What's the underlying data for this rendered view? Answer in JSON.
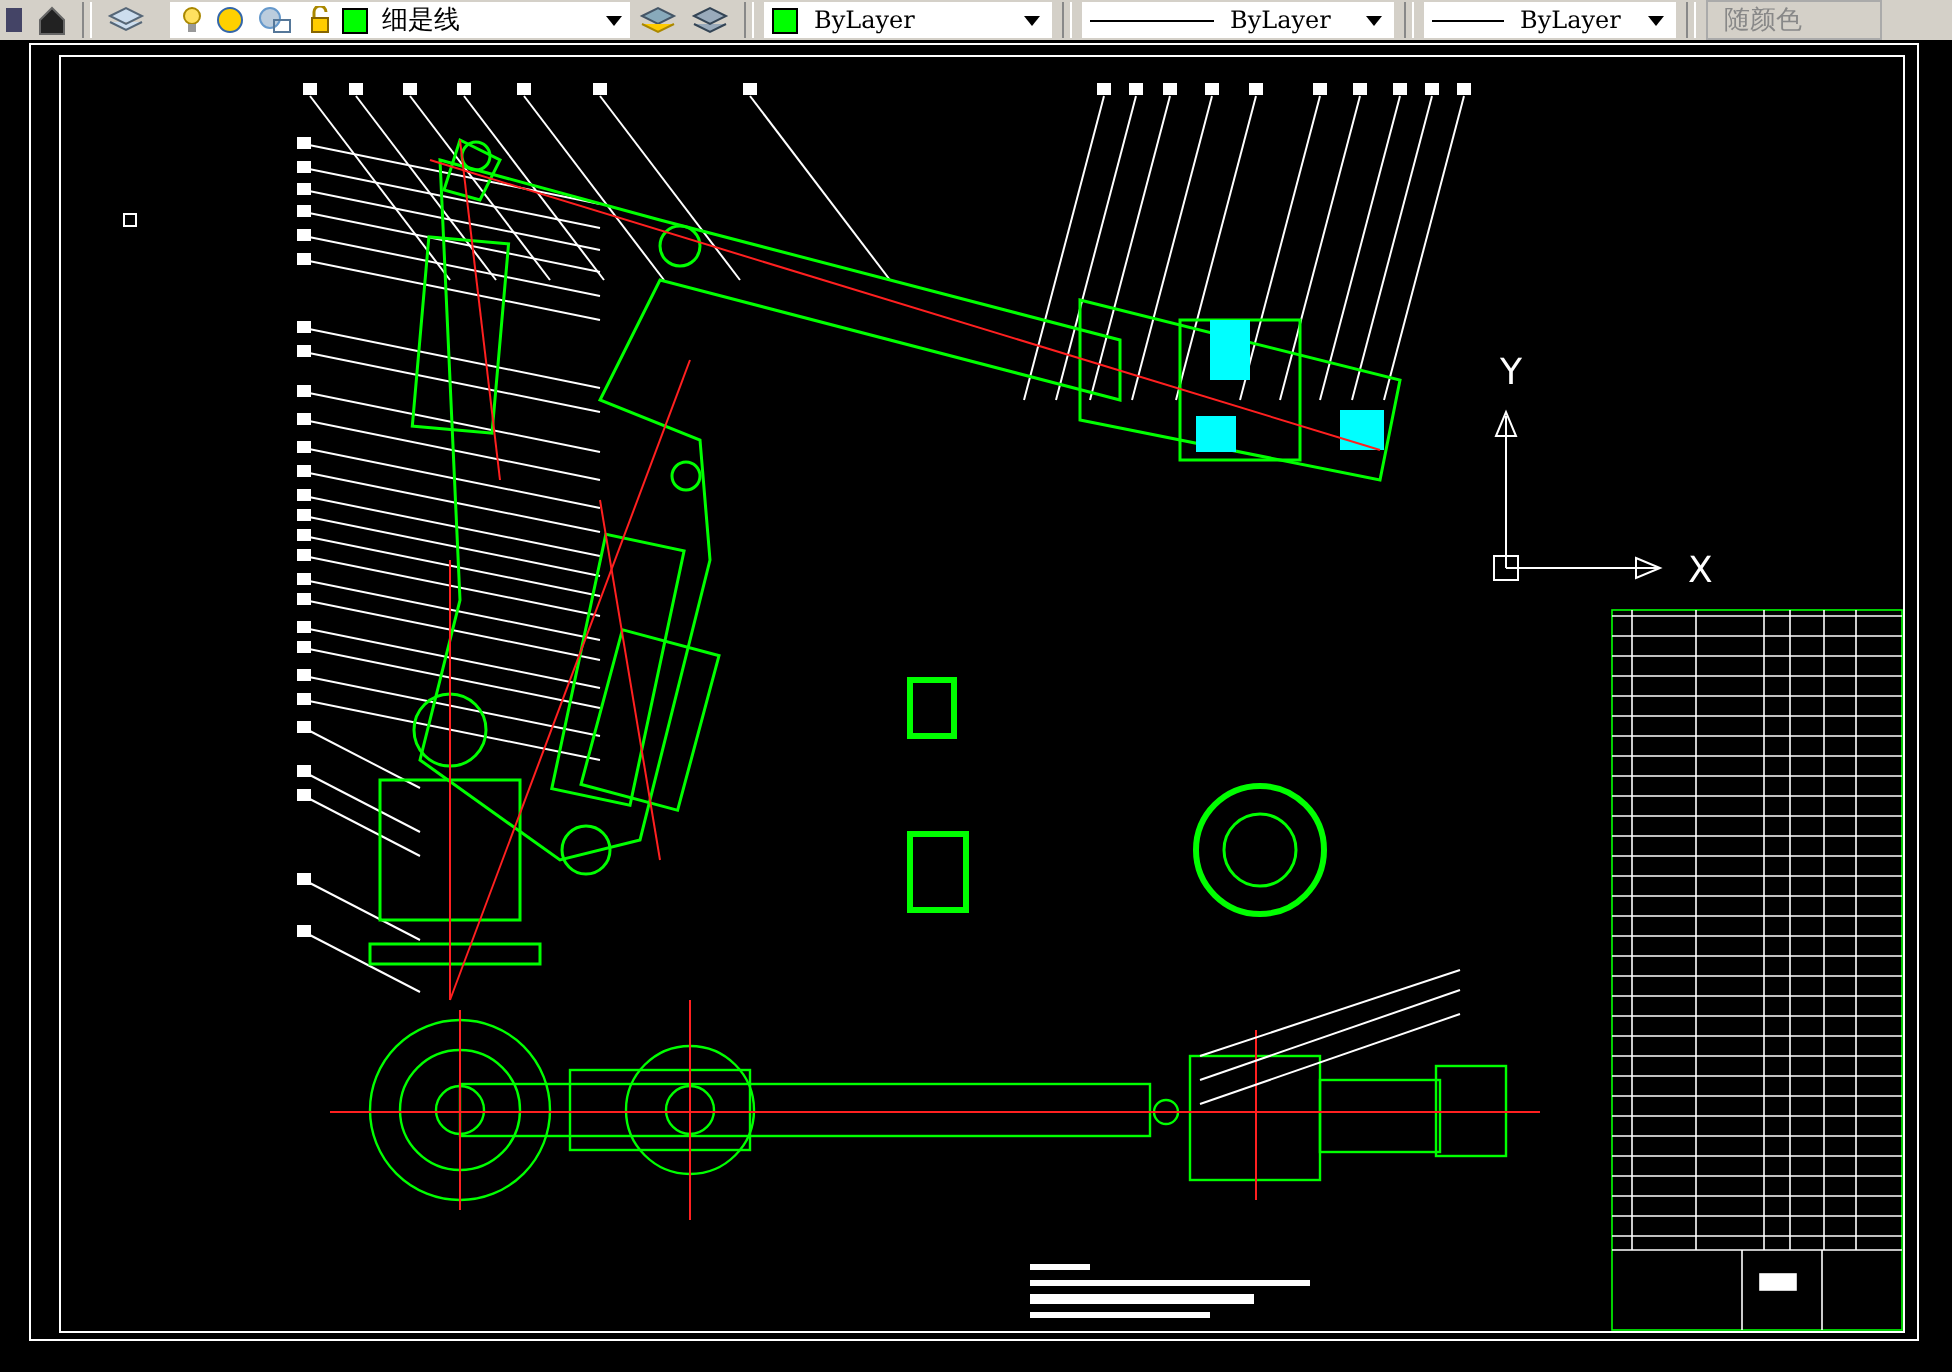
{
  "toolbar": {
    "layer": {
      "name": "细是线",
      "color": "#00ff00"
    },
    "color_combo": {
      "label": "ByLayer",
      "color": "#00ff00"
    },
    "linetype": {
      "label": "ByLayer"
    },
    "lineweight": {
      "label": "ByLayer"
    },
    "plot_style": {
      "label": "随颜色",
      "disabled": true
    }
  },
  "canvas": {
    "ucs": {
      "x_label": "X",
      "y_label": "Y"
    }
  }
}
